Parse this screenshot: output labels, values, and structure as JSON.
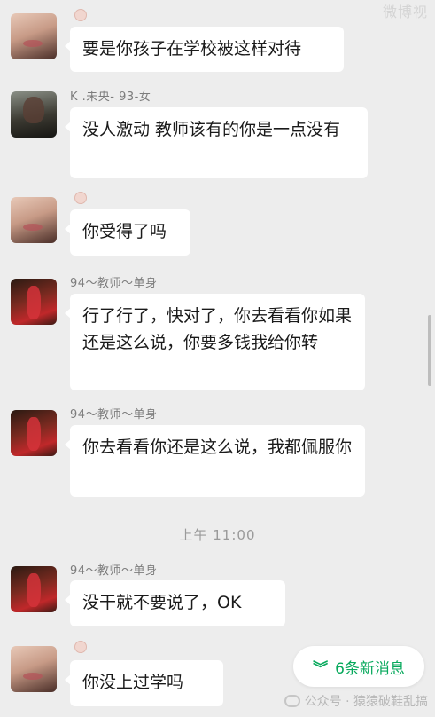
{
  "watermark_top": "微博视",
  "messages": [
    {
      "sender": "",
      "text": "要是你孩子在学校被这样对待"
    },
    {
      "sender": "K .未央- 93-女",
      "text": "没人激动 教师该有的你是一点没有"
    },
    {
      "sender": "",
      "text": "你受得了吗"
    },
    {
      "sender": "94～教师～单身",
      "text": "行了行了，快对了，你去看看你如果还是这么说，你要多钱我给你转"
    },
    {
      "sender": "94～教师～单身",
      "text": "你去看看你还是这么说，我都佩服你"
    },
    {
      "sender": "94～教师～单身",
      "text": "没干就不要说了，OK"
    },
    {
      "sender": "",
      "text": "你没上过学吗"
    }
  ],
  "timestamp": "上午 11:00",
  "new_messages": {
    "label": "6条新消息",
    "icon": "double-chevron-down-icon"
  },
  "watermark_bottom": "公众号 · 猿猿破鞋乱搞",
  "colors": {
    "background": "#ededed",
    "bubble": "#ffffff",
    "accent_green": "#07a95c"
  }
}
